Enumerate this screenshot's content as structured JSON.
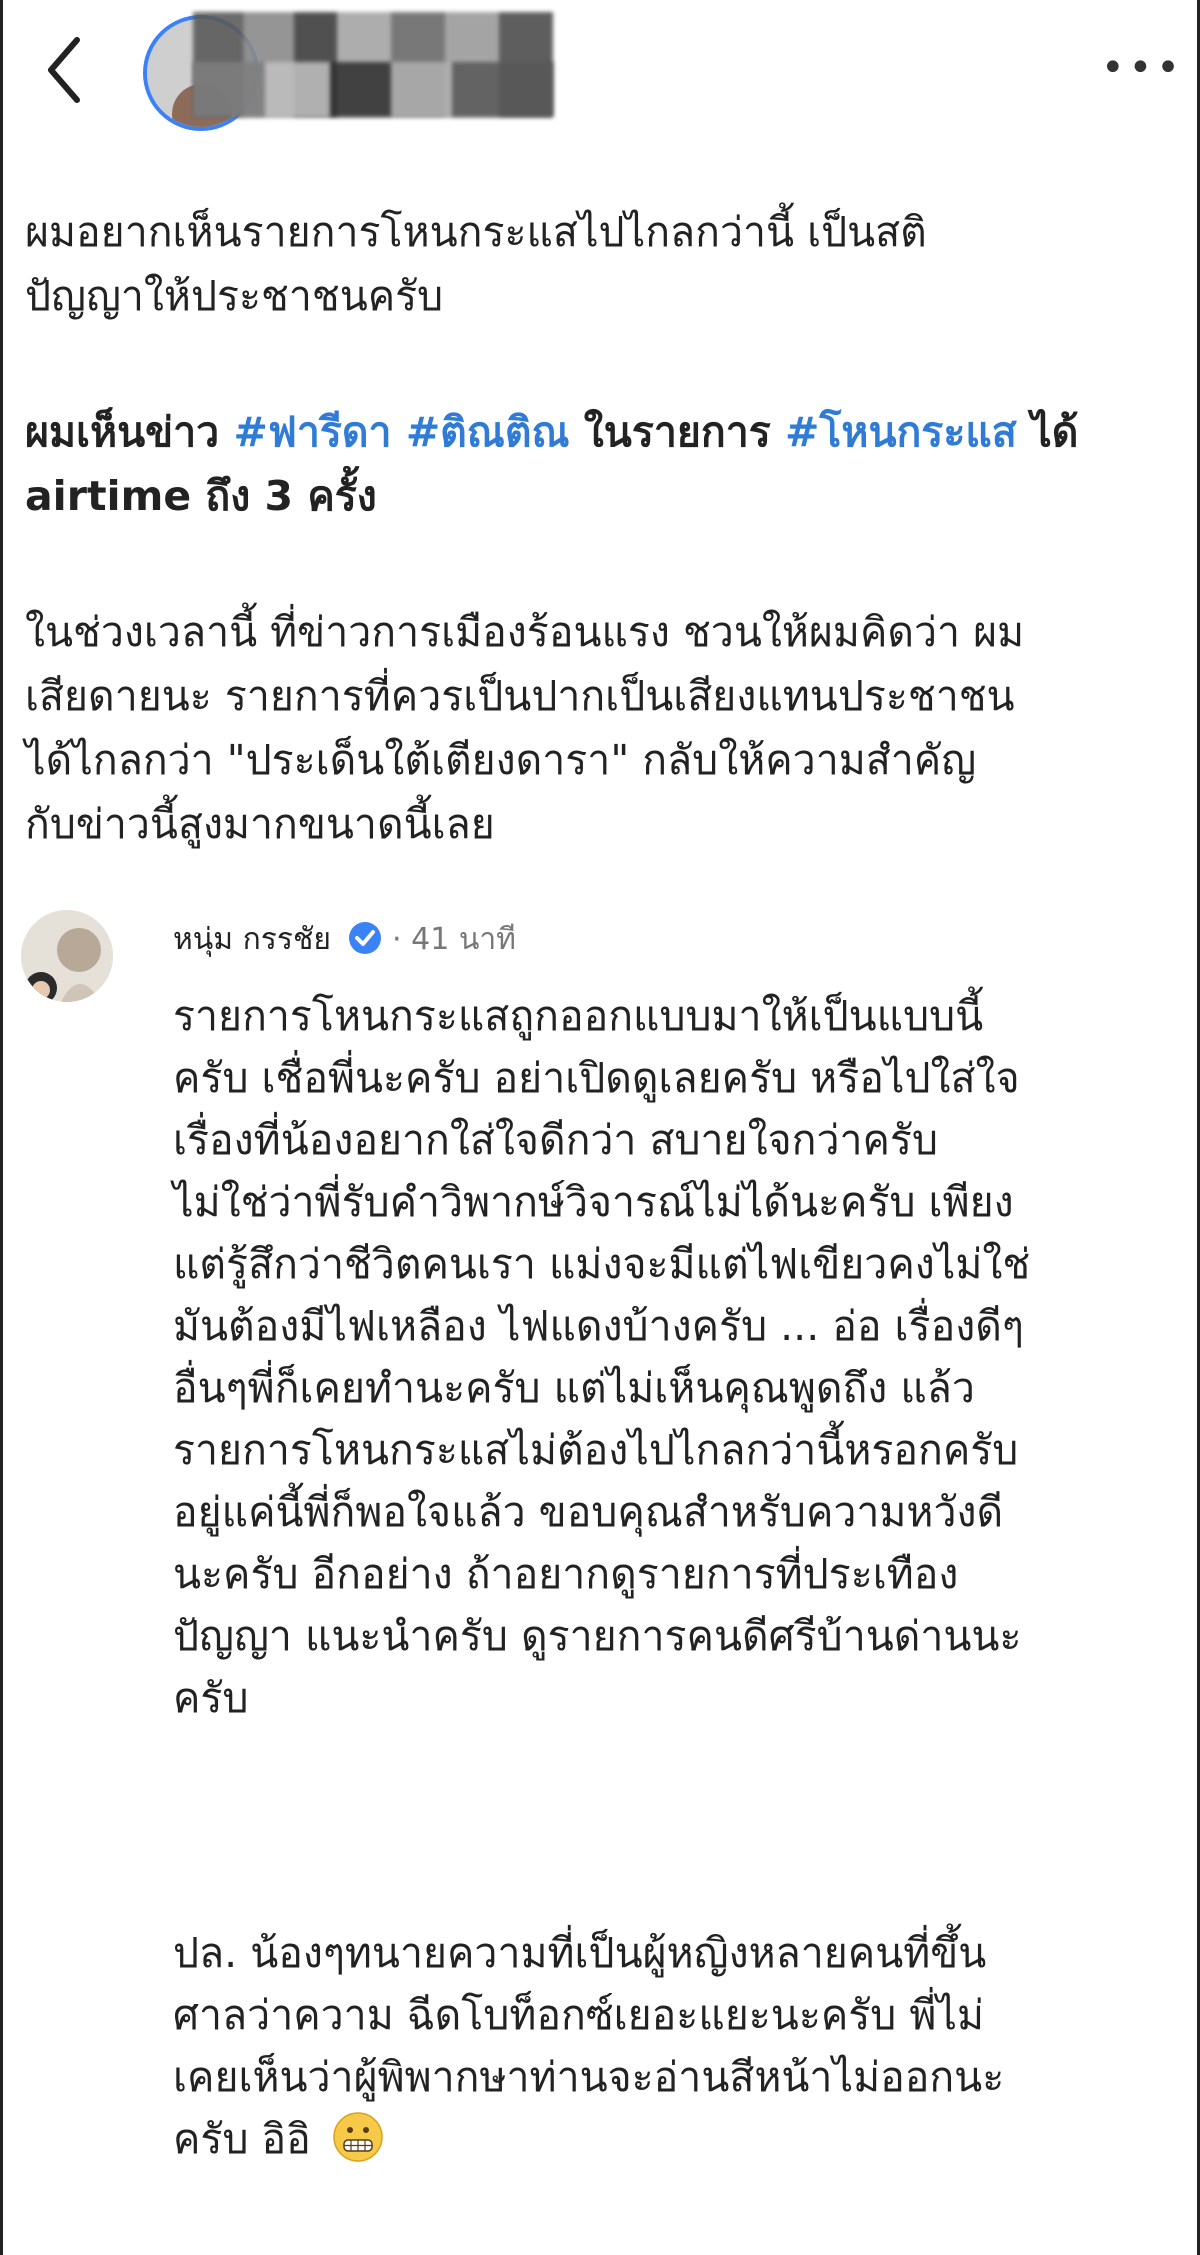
{
  "post": {
    "paragraphs": [
      {
        "lines": [
          "ผมอยากเห็นรายการโหนกระแสไปไกลกว่านี้ เป็นสติ",
          "ปัญญาให้ประชาชนครับ"
        ]
      },
      {
        "line1_prefix": "ผมเห็นข่าว ",
        "tag1": "#ฟารีดา",
        "tag2": "#ติณติณ",
        "mid": " ในรายการ ",
        "tag3": "#โหนกระแส",
        "line1_suffix": " ได้",
        "line2": "airtime ถึง 3 ครั้ง"
      },
      {
        "lines": [
          "ในช่วงเวลานี้ ที่ข่าวการเมืองร้อนแรง ชวนให้ผมคิดว่า ผม",
          "เสียดายนะ รายการที่ควรเป็นปากเป็นเสียงแทนประชาชน",
          "ได้ไกลกว่า \"ประเด็นใต้เตียงดารา\" กลับให้ความสำคัญ",
          "กับข่าวนี้สูงมากขนาดนี้เลย"
        ]
      }
    ]
  },
  "comment": {
    "author": "หนุ่ม กรรชัย",
    "separator": " · ",
    "time": "41 นาที",
    "lines": [
      "รายการโหนกระแสถูกออกแบบมาให้เป็นแบบนี้",
      "ครับ  เชื่อพี่นะครับ อย่าเปิดดูเลยครับ หรือไปใส่ใจ",
      "เรื่องที่น้องอยากใส่ใจดีกว่า สบายใจกว่าครับ",
      "ไม่ใช่ว่าพี่รับคำวิพากษ์วิจารณ์ไม่ได้นะครับ เพียง",
      "แต่รู้สึกว่าชีวิตคนเรา แม่งจะมีแต่ไฟเขียวคงไม่ใช่",
      "มันต้องมีไฟเหลือง ไฟแดงบ้างครับ ... อ่อ เรื่องดีๆ",
      "อื่นๆพี่ก็เคยทำนะครับ แต่ไม่เห็นคุณพูดถึง แล้ว",
      "รายการโหนกระแสไม่ต้องไปไกลกว่านี้หรอกครับ",
      "อยู่แค่นี้พี่ก็พอใจแล้ว ขอบคุณสำหรับความหวังดี",
      "นะครับ อีกอย่าง ถ้าอยากดูรายการที่ประเทือง",
      "ปัญญา แนะนำครับ ดูรายการคนดีศรีบ้านด่านนะ",
      "ครับ"
    ],
    "ps_lines": [
      "ปล. น้องๆทนายความที่เป็นผู้หญิงหลายคนที่ขึ้น",
      "ศาลว่าความ  ฉีดโบท็อกซ์เยอะแยะนะครับ พี่ไม่",
      "เคยเห็นว่าผู้พิพากษาท่านจะอ่านสีหน้าไม่ออกนะ",
      "ครับ อิอิ"
    ]
  },
  "icons": {
    "back": "back-chevron-icon",
    "more": "more-dots-icon",
    "verified": "verified-badge-icon",
    "emoji": "grimacing-face-emoji-icon"
  },
  "colors": {
    "hashtag": "#2f7bd6",
    "verified": "#3b82f6",
    "avatar_ring": "#3b82f6"
  }
}
